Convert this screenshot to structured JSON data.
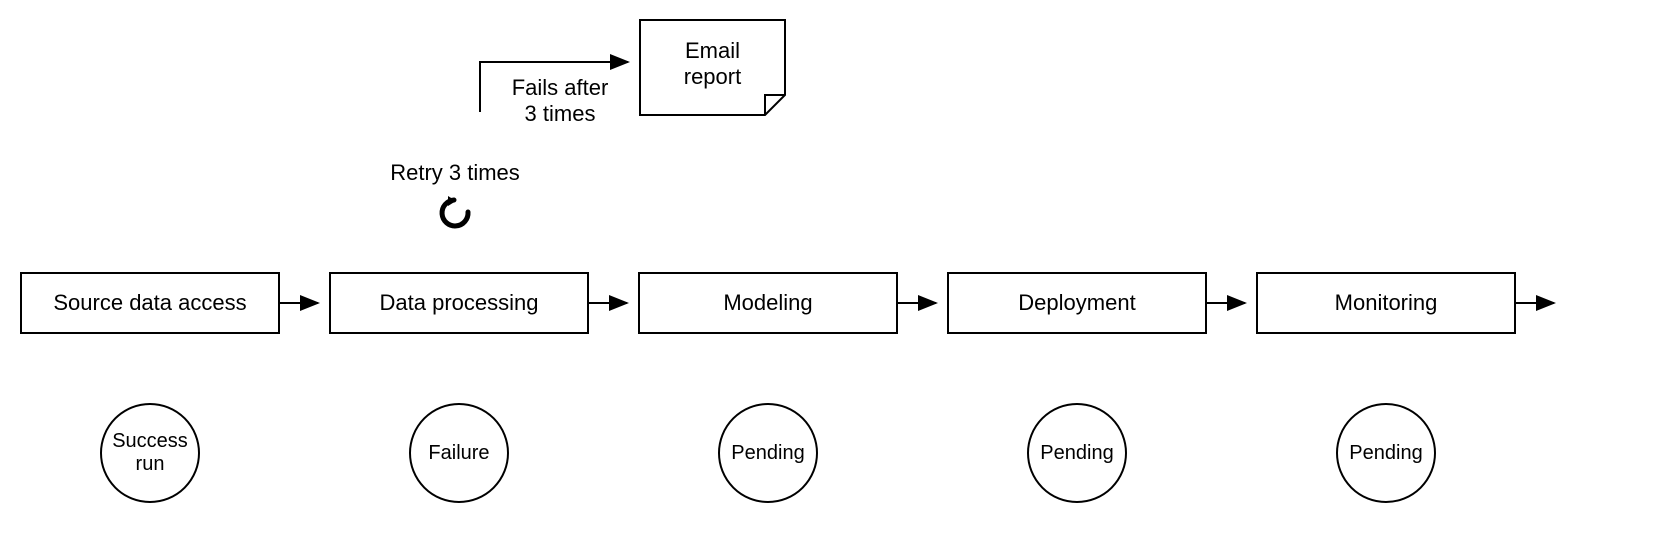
{
  "steps": {
    "0": {
      "label": "Source data access",
      "status": "Success\nrun"
    },
    "1": {
      "label": "Data processing",
      "status": "Failure"
    },
    "2": {
      "label": "Modeling",
      "status": "Pending"
    },
    "3": {
      "label": "Deployment",
      "status": "Pending"
    },
    "4": {
      "label": "Monitoring",
      "status": "Pending"
    }
  },
  "retry_label": "Retry 3 times",
  "fail_after_label": "Fails after\n3 times",
  "email_note": "Email\nreport"
}
